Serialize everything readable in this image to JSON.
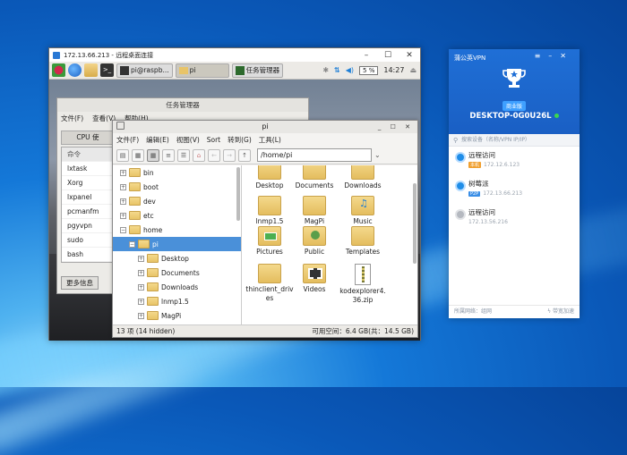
{
  "remote": {
    "title": "172.13.66.213 - 远程桌面连接",
    "taskbar": {
      "apps": [
        {
          "label": "pi@raspb...",
          "kind": "terminal"
        },
        {
          "label": "pi",
          "kind": "folder"
        },
        {
          "label": "任务管理器",
          "kind": "monitor"
        }
      ],
      "cpu": "5 %",
      "clock": "14:27"
    },
    "task_manager": {
      "title": "任务管理器",
      "menu": [
        "文件(F)",
        "查看(V)",
        "帮助(H)"
      ],
      "tab": "CPU 使",
      "column": "命令",
      "processes": [
        "lxtask",
        "Xorg",
        "lxpanel",
        "pcmanfm",
        "pgyvpn",
        "sudo",
        "bash"
      ],
      "more_button": "更多信息"
    },
    "file_manager": {
      "title": "pi",
      "menu": [
        "文件(F)",
        "编辑(E)",
        "视图(V)",
        "Sort",
        "转到(G)",
        "工具(L)"
      ],
      "path": "/home/pi",
      "tree": [
        {
          "label": "bin",
          "level": 0,
          "expander": "+"
        },
        {
          "label": "boot",
          "level": 0,
          "expander": "+"
        },
        {
          "label": "dev",
          "level": 0,
          "expander": "+"
        },
        {
          "label": "etc",
          "level": 0,
          "expander": "+"
        },
        {
          "label": "home",
          "level": 0,
          "expander": "−"
        },
        {
          "label": "pi",
          "level": 1,
          "expander": "−",
          "selected": true
        },
        {
          "label": "Desktop",
          "level": 2,
          "expander": "+"
        },
        {
          "label": "Documents",
          "level": 2,
          "expander": "+"
        },
        {
          "label": "Downloads",
          "level": 2,
          "expander": "+"
        },
        {
          "label": "lnmp1.5",
          "level": 2,
          "expander": "+"
        },
        {
          "label": "MagPi",
          "level": 2,
          "expander": "+"
        }
      ],
      "items": [
        {
          "label": "Desktop",
          "icon": "folder"
        },
        {
          "label": "Documents",
          "icon": "folder"
        },
        {
          "label": "Downloads",
          "icon": "folder"
        },
        {
          "label": "lnmp1.5",
          "icon": "folder"
        },
        {
          "label": "MagPi",
          "icon": "folder"
        },
        {
          "label": "Music",
          "icon": "music-folder"
        },
        {
          "label": "Pictures",
          "icon": "pictures-folder"
        },
        {
          "label": "Public",
          "icon": "public-folder"
        },
        {
          "label": "Templates",
          "icon": "folder"
        },
        {
          "label": "thinclient_drives",
          "icon": "folder"
        },
        {
          "label": "Videos",
          "icon": "video-folder"
        },
        {
          "label": "kodexplorer4.36.zip",
          "icon": "zip-file"
        }
      ],
      "status_left": "13 项 (14 hidden)",
      "status_right": "可用空间：6.4 GB(共：14.5 GB)"
    }
  },
  "vpn": {
    "title": "蒲公英VPN",
    "edition_badge": "商业版",
    "hostname": "DESKTOP-0G0U26L",
    "search_placeholder": "搜索设备（名称/VPN IP/IP）",
    "devices": [
      {
        "name": "远程访问",
        "tag": "本机",
        "tag_color": "#f0a030",
        "ip": "172.12.6.123",
        "online": true
      },
      {
        "name": "树莓派",
        "tag": "P2P",
        "tag_color": "#3a8ee6",
        "ip": "172.13.66.213",
        "online": true
      },
      {
        "name": "远程访问",
        "tag": "",
        "tag_color": "",
        "ip": "172.13.56.216",
        "online": false
      }
    ],
    "footer_left": "所属网络：组网",
    "footer_right": "带宽加速"
  }
}
